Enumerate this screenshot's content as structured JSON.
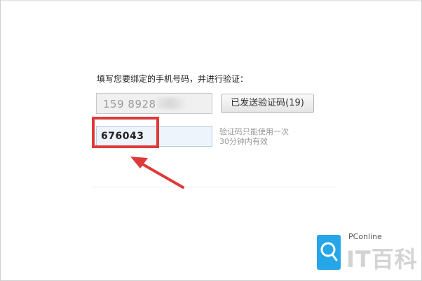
{
  "form": {
    "prompt": "填写您要绑定的手机号码，并进行验证：",
    "phone_value": "159 8928",
    "send_button_label": "已发送验证码(19)",
    "code_value": "676043",
    "hint_line1": "验证码只能使用一次",
    "hint_line2": "30分钟内有效"
  },
  "watermark": {
    "brand": "PConline",
    "name": "IT百科"
  },
  "colors": {
    "highlight": "#df3a3a",
    "watermark_blue": "#25a6e8"
  }
}
